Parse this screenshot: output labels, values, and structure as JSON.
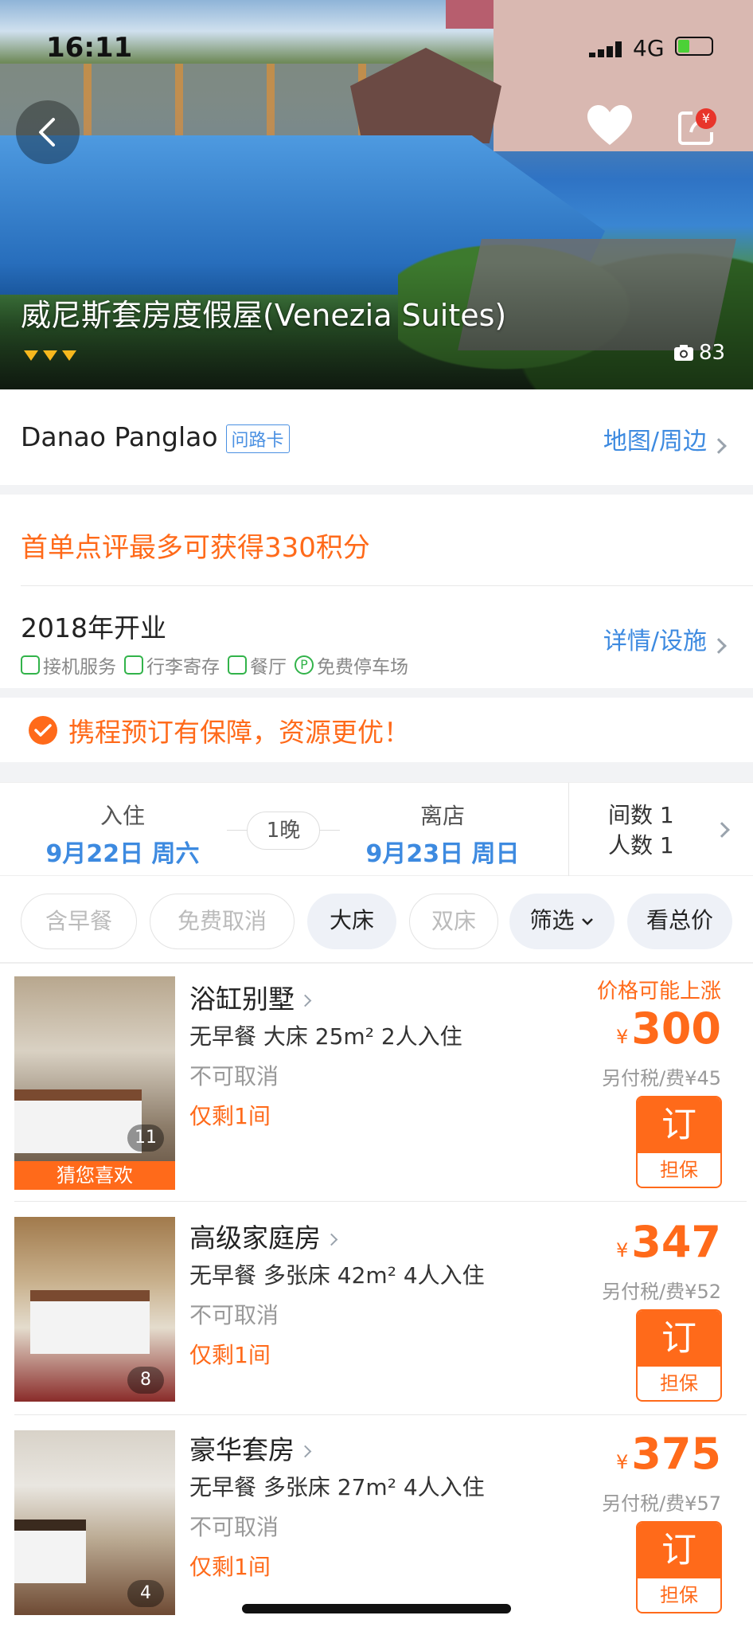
{
  "status_bar": {
    "time": "16:11",
    "network": "4G"
  },
  "hotel": {
    "name": "威尼斯套房度假屋(Venezia Suites)",
    "photo_count": "83",
    "share_badge": "¥",
    "stars": 3
  },
  "address": {
    "text": "Danao Panglao",
    "card_label": "问路卡",
    "map_link": "地图/周边"
  },
  "promo": {
    "points_text": "首单点评最多可获得330积分"
  },
  "info": {
    "opened": "2018年开业",
    "detail_link": "详情/设施",
    "facilities": [
      "接机服务",
      "行李寄存",
      "餐厅",
      "免费停车场"
    ]
  },
  "guarantee": {
    "text": "携程预订有保障，资源更优！"
  },
  "booking": {
    "checkin_label": "入住",
    "checkin_date": "9月22日 周六",
    "nights": "1晚",
    "checkout_label": "离店",
    "checkout_date": "9月23日 周日",
    "rooms": "间数 1",
    "guests": "人数 1"
  },
  "filters": [
    "含早餐",
    "免费取消",
    "大床",
    "双床",
    "筛选",
    "看总价"
  ],
  "rooms": [
    {
      "name": "浴缸别墅",
      "info": "无早餐 大床  25m²  2人入住",
      "cancel": "不可取消",
      "left": "仅剩1间",
      "price_note": "价格可能上涨",
      "currency": "¥",
      "price": "300",
      "tax": "另付税/费¥45",
      "photos": "11",
      "ribbon": "猜您喜欢",
      "book": "订",
      "guarantee": "担保"
    },
    {
      "name": "高级家庭房",
      "info": "无早餐 多张床  42m²  4人入住",
      "cancel": "不可取消",
      "left": "仅剩1间",
      "currency": "¥",
      "price": "347",
      "tax": "另付税/费¥52",
      "photos": "8",
      "book": "订",
      "guarantee": "担保"
    },
    {
      "name": "豪华套房",
      "info": "无早餐 多张床  27m²  4人入住",
      "cancel": "不可取消",
      "left": "仅剩1间",
      "currency": "¥",
      "price": "375",
      "tax": "另付税/费¥57",
      "photos": "4",
      "book": "订",
      "guarantee": "担保"
    }
  ],
  "colors": {
    "accent": "#ff6a1a",
    "link": "#3d8ae0",
    "green": "#32b34a"
  }
}
